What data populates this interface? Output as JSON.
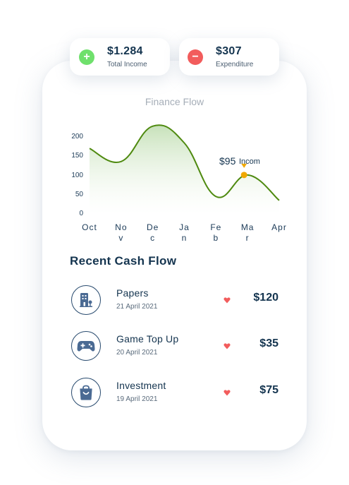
{
  "summary": {
    "income": {
      "amount": "$1.284",
      "label": "Total Income",
      "badge": "+"
    },
    "expenditure": {
      "amount": "$307",
      "label": "Expenditure",
      "badge": "−"
    }
  },
  "chart_data": {
    "type": "area",
    "title": "Finance Flow",
    "categories": [
      "Oct",
      "Nov",
      "Dec",
      "Jan",
      "Feb",
      "Mar",
      "Apr"
    ],
    "y_ticks": [
      "200",
      "150",
      "100",
      "50",
      "0"
    ],
    "ylim": [
      0,
      200
    ],
    "series": [
      {
        "values": [
          172,
          138,
          230,
          186,
          47,
          103,
          37
        ]
      }
    ],
    "highlight": {
      "category": "Mar",
      "value": 95,
      "amount_label": "$95",
      "text": "Incom"
    },
    "colors": {
      "line": "#4f8a10",
      "fill": "#cfe6c4",
      "marker": "#f0a800"
    }
  },
  "recent": {
    "title": "Recent Cash Flow",
    "items": [
      {
        "name": "Papers",
        "date": "21 April 2021",
        "amount": "$120",
        "icon": "building-icon"
      },
      {
        "name": "Game Top Up",
        "date": "20 April 2021",
        "amount": "$35",
        "icon": "gamepad-icon"
      },
      {
        "name": "Investment",
        "date": "19 April 2021",
        "amount": "$75",
        "icon": "shopping-bag-icon"
      }
    ],
    "direction_icon": "down-heart-icon",
    "direction_color": "#f25c5c"
  }
}
